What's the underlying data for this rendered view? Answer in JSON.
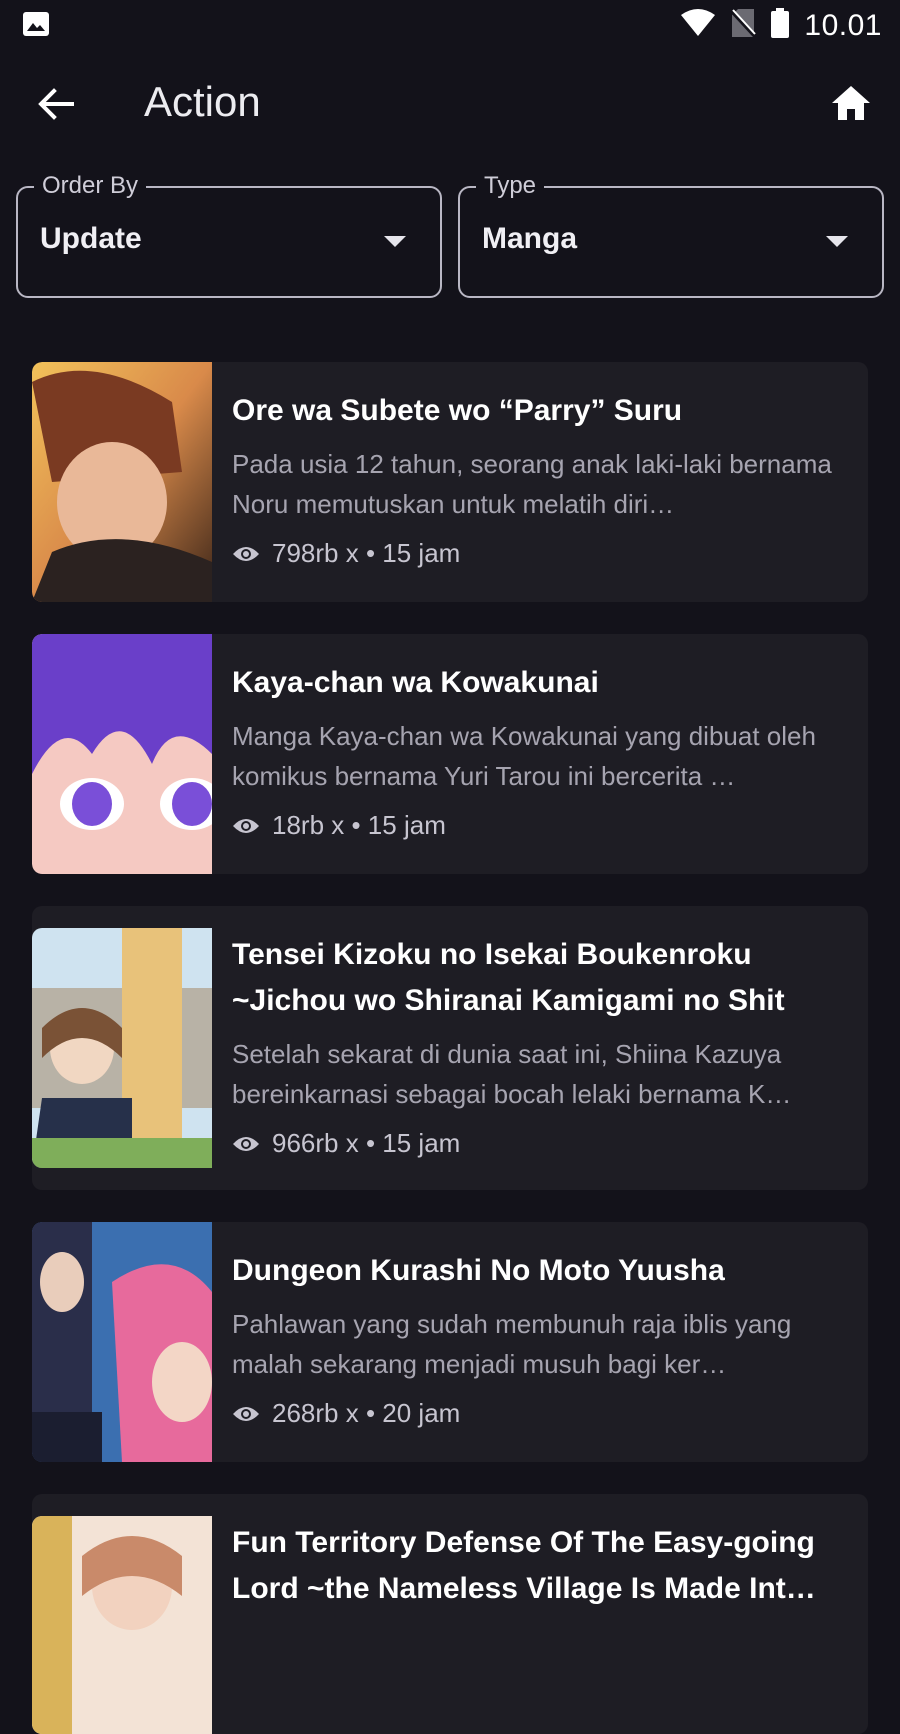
{
  "status": {
    "time": "10.01"
  },
  "header": {
    "title": "Action",
    "back_icon": "arrow-back-icon",
    "home_icon": "home-icon"
  },
  "filters": {
    "order_by": {
      "label": "Order By",
      "value": "Update"
    },
    "type": {
      "label": "Type",
      "value": "Manga"
    }
  },
  "colors": {
    "background": "#13121a",
    "card": "#1e1d24",
    "muted_text": "#a6a4b0"
  },
  "items": [
    {
      "title": "Ore wa Subete wo “Parry” Suru",
      "desc": "Pada usia 12 tahun, seorang anak laki-laki bernama Noru memutuskan untuk melatih diri…",
      "meta": "798rb x • 15 jam"
    },
    {
      "title": "Kaya-chan wa Kowakunai",
      "desc": "Manga Kaya-chan wa Kowakunai yang dibuat oleh komikus bernama Yuri Tarou ini bercerita …",
      "meta": "18rb x • 15 jam"
    },
    {
      "title": "Tensei Kizoku no Isekai Boukenroku ~Jichou wo Shiranai Kamigami no Shit",
      "desc": "Setelah sekarat di dunia saat ini, Shiina Kazuya bereinkarnasi sebagai bocah lelaki bernama K…",
      "meta": "966rb x • 15 jam"
    },
    {
      "title": "Dungeon Kurashi No Moto Yuusha",
      "desc": "Pahlawan yang sudah membunuh raja iblis yang malah sekarang menjadi musuh bagi ker…",
      "meta": "268rb x • 20 jam"
    },
    {
      "title": "Fun Territory Defense Of The Easy-going Lord ~the Nameless Village Is Made Int…",
      "desc": "",
      "meta": ""
    }
  ]
}
